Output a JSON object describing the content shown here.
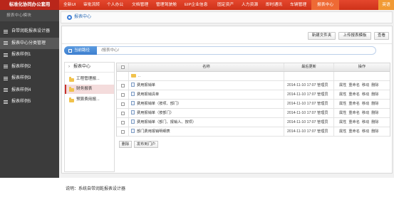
{
  "header": {
    "app_title": "标准化协同办公套用",
    "nav": [
      {
        "label": "全新UI",
        "active": false
      },
      {
        "label": "审批流转",
        "active": false
      },
      {
        "label": "个人办公",
        "active": false
      },
      {
        "label": "文档管理",
        "active": false
      },
      {
        "label": "管理驾驶舱",
        "active": false
      },
      {
        "label": "EIP企业信息",
        "active": false
      },
      {
        "label": "固定资产",
        "active": false
      },
      {
        "label": "人力资源",
        "active": false
      },
      {
        "label": "即时通讯",
        "active": false
      },
      {
        "label": "车辆管理",
        "active": false
      },
      {
        "label": "报表中心",
        "active": true
      }
    ],
    "right_label": "英语"
  },
  "sidebar": {
    "module_title": "报表中心模块",
    "items": [
      {
        "label": "自带润乾报表设计器",
        "icon": "list-icon",
        "active": false
      },
      {
        "label": "报表中心分类管理",
        "icon": "list-icon",
        "active": true
      },
      {
        "label": "报表样例1",
        "icon": "list-icon",
        "active": false
      },
      {
        "label": "报表样例2",
        "icon": "list-icon",
        "active": false
      },
      {
        "label": "报表样例3",
        "icon": "list-icon",
        "active": false
      },
      {
        "label": "报表样例4",
        "icon": "list-icon",
        "active": false
      },
      {
        "label": "报表样例5",
        "icon": "list-icon",
        "active": false
      }
    ]
  },
  "breadcrumb": {
    "icon": "report-center-icon",
    "label": "报表中心"
  },
  "toolbar": {
    "new_folder_label": "新建文件夹",
    "upload_template_label": "上传报表模板",
    "view_label": "查看"
  },
  "path": {
    "icon": "path-icon",
    "label": "当前路径",
    "value": "/报表中心/"
  },
  "tree": {
    "root_icon": "chevron-right-icon",
    "root_label": "报表中心",
    "items": [
      {
        "label": "工程管理报...",
        "icon": "folder-icon",
        "selected": false
      },
      {
        "label": "财务报表",
        "icon": "folder-icon",
        "selected": true
      },
      {
        "label": "预算费用报...",
        "icon": "folder-icon",
        "selected": false
      }
    ]
  },
  "table": {
    "columns": [
      "名称",
      "最后更新",
      "操作"
    ],
    "parent_row": {
      "name": "..",
      "icon": "folder-icon"
    },
    "rows": [
      {
        "name": "费用报销单",
        "icon": "document-icon",
        "updated": "2014-11-10 17:07",
        "user": "管理员",
        "actions": [
          "属性",
          "重命名",
          "移动",
          "删除"
        ]
      },
      {
        "name": "费用报销清单",
        "icon": "document-icon",
        "updated": "2014-11-10 17:07",
        "user": "管理员",
        "actions": [
          "属性",
          "重命名",
          "移动",
          "删除"
        ]
      },
      {
        "name": "费用报销单（按项、部门）",
        "icon": "document-icon",
        "updated": "2014-11-10 17:07",
        "user": "管理员",
        "actions": [
          "属性",
          "重命名",
          "移动",
          "删除"
        ]
      },
      {
        "name": "费用报销单（按部门）",
        "icon": "document-icon",
        "updated": "2014-11-10 17:07",
        "user": "管理员",
        "actions": [
          "属性",
          "重命名",
          "移动",
          "删除"
        ]
      },
      {
        "name": "费用报销单（部门、报销人、按项）",
        "icon": "document-icon",
        "updated": "2014-11-10 17:07",
        "user": "管理员",
        "actions": [
          "属性",
          "重命名",
          "移动",
          "删除"
        ]
      },
      {
        "name": "部门费用报销明细表",
        "icon": "document-icon",
        "updated": "2014-11-10 17:07",
        "user": "管理员",
        "actions": [
          "属性",
          "重命名",
          "移动",
          "删除"
        ]
      }
    ]
  },
  "bulk_actions": {
    "delete_label": "删除",
    "publish_label": "发布到门户"
  },
  "note": "说明：系统自带润乾报表设计器",
  "colors": {
    "header_red": "#d83a22",
    "active_nav_orange": "#ee6a34",
    "sidebar_bg": "#3b3b3b",
    "path_tab_blue": "#3d7fcf",
    "selected_red": "#c9302c",
    "folder_yellow": "#f1c24c"
  }
}
